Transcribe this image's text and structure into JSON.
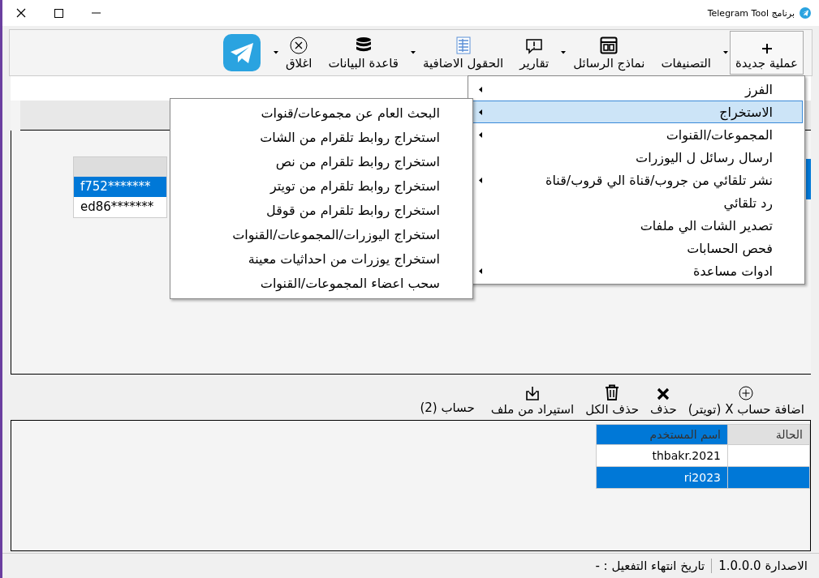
{
  "window": {
    "title": "برنامج Telegram Tool"
  },
  "toolbar": [
    {
      "label": "عملية جديدة",
      "has_dropdown": true,
      "pressed": true
    },
    {
      "label": "التصنيفات",
      "has_dropdown": false,
      "pressed": false
    },
    {
      "label": "نماذج الرسائل",
      "has_dropdown": true,
      "pressed": false
    },
    {
      "label": "تقارير",
      "has_dropdown": false,
      "pressed": false
    },
    {
      "label": "الحقول الاضافية",
      "has_dropdown": true,
      "pressed": false
    },
    {
      "label": "قاعدة البيانات",
      "has_dropdown": false,
      "pressed": false
    },
    {
      "label": "اغلاق",
      "has_dropdown": true,
      "pressed": false
    }
  ],
  "background_list": [
    {
      "text": "f752*******",
      "selected": true
    },
    {
      "text": "ed86*******",
      "selected": false
    }
  ],
  "menu": [
    {
      "label": "الفرز",
      "has_submenu": true,
      "selected": false
    },
    {
      "label": "الاستخراج",
      "has_submenu": true,
      "selected": true
    },
    {
      "label": "المجموعات/القنوات",
      "has_submenu": true,
      "selected": false
    },
    {
      "label": "ارسال رسائل ل اليوزرات",
      "has_submenu": false,
      "selected": false
    },
    {
      "label": "نشر تلقائي من جروب/قناة الي قروب/قناة",
      "has_submenu": true,
      "selected": false
    },
    {
      "label": "رد تلقائي",
      "has_submenu": false,
      "selected": false
    },
    {
      "label": "تصدير الشات الي ملفات",
      "has_submenu": false,
      "selected": false
    },
    {
      "label": "فحص الحسابات",
      "has_submenu": false,
      "selected": false
    },
    {
      "label": "ادوات مساعدة",
      "has_submenu": true,
      "selected": false
    }
  ],
  "submenu": [
    {
      "label": "البحث العام عن مجموعات/قنوات",
      "selected": false
    },
    {
      "label": "استخراج روابط  تلقرام من الشات",
      "selected": false
    },
    {
      "label": "استخراج روابط  تلقرام من نص",
      "selected": false
    },
    {
      "label": "استخراج روابط تلقرام من تويتر",
      "selected": false
    },
    {
      "label": "استخراج روابط  تلقرام من قوقل",
      "selected": false
    },
    {
      "label": "استخراج  اليوزرات/المجموعات/القنوات",
      "selected": false
    },
    {
      "label": "استخراج يوزرات من احداثيات معينة",
      "selected": false
    },
    {
      "label": "سحب  اعضاء المجموعات/القنوات",
      "selected": false
    }
  ],
  "accounts_toolbar": {
    "buttons": [
      {
        "label": "اضافة حساب X (تويتر)"
      },
      {
        "label": "حذف"
      },
      {
        "label": "حذف الكل"
      },
      {
        "label": "استيراد من ملف"
      }
    ],
    "count": "حساب (2)"
  },
  "accounts_table": {
    "columns": [
      "الحالة",
      "اسم المستخدم"
    ],
    "rows": [
      {
        "username": "thbakr.2021",
        "selected": false
      },
      {
        "username": "ri2023",
        "selected": true
      }
    ]
  },
  "status_bar": {
    "version": "الاصدارة 1.0.0.0",
    "expiry": "تاريخ انتهاء التفعيل : -"
  }
}
